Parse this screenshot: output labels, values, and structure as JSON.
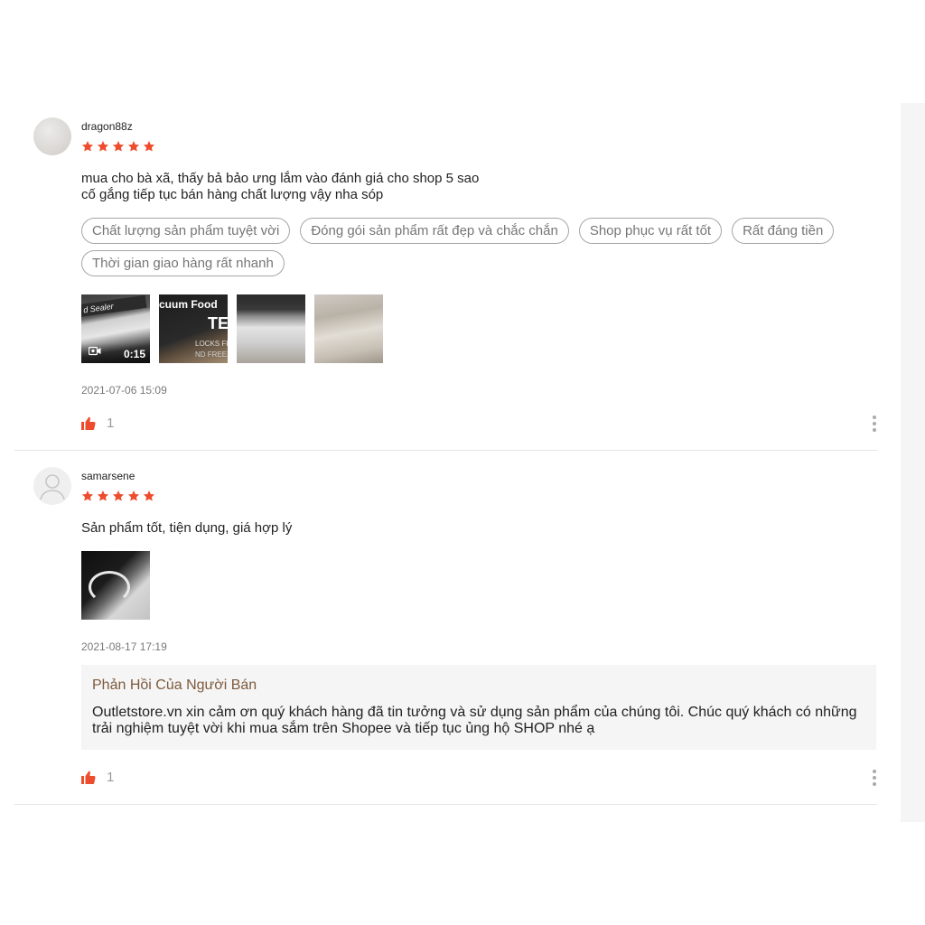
{
  "colors": {
    "star": "#ee4d2d",
    "like": "#ee4d2d",
    "seller_title": "#7d5a3c",
    "seller_bg": "#f5f5f5"
  },
  "reviews": [
    {
      "username": "dragon88z",
      "rating": 5,
      "comment": "mua cho bà xã, thấy bả bảo ưng lắm vào đánh giá cho shop 5 sao\ncố gắng tiếp tục bán hàng chất lượng vậy nha sóp",
      "tags": [
        "Chất lượng sản phẩm tuyệt vời",
        "Đóng gói sản phẩm rất đẹp và chắc chắn",
        "Shop phục vụ rất tốt",
        "Rất đáng tiền",
        "Thời gian giao hàng rất nhanh"
      ],
      "media": {
        "video_duration": "0:15",
        "video_overlay_text": "d Sealer",
        "product_overlay_line1": "cuum Food",
        "product_overlay_line2": "TE",
        "product_overlay_line3": "LOCKS FR",
        "product_overlay_line4": "ND FREEZ"
      },
      "date": "2021-07-06 15:09",
      "likes": "1"
    },
    {
      "username": "samarsene",
      "rating": 5,
      "comment": "Sản phẩm tốt, tiện dụng, giá hợp lý",
      "date": "2021-08-17 17:19",
      "seller_reply": {
        "title": "Phản Hồi Của Người Bán",
        "text": "Outletstore.vn xin cảm ơn quý khách hàng đã tin tưởng và sử dụng sản phẩm của chúng tôi. Chúc quý khách có những trải nghiệm tuyệt vời khi mua sắm trên Shopee và tiếp tục ủng hộ SHOP nhé ạ"
      },
      "likes": "1"
    }
  ]
}
